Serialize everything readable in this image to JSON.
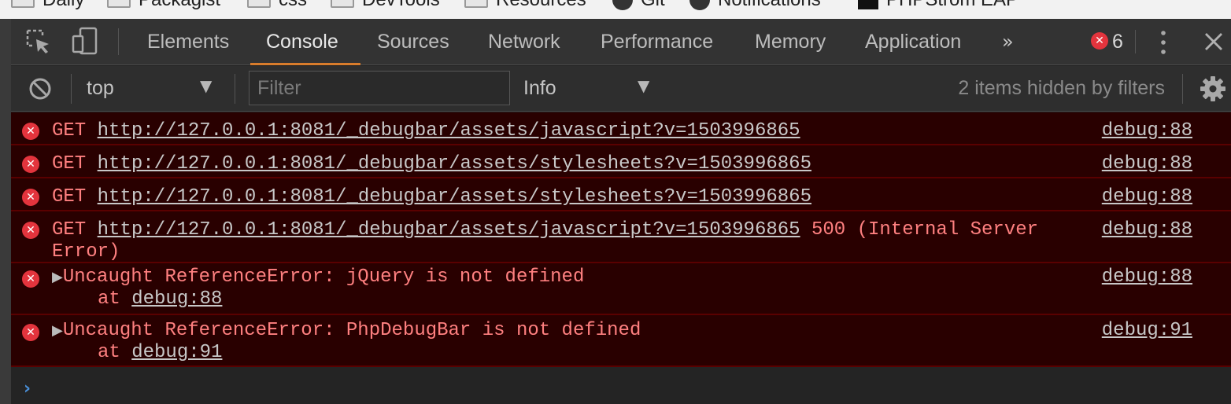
{
  "bookmarks": [
    {
      "label": "Daily",
      "icon": "folder-icon"
    },
    {
      "label": "Packagist",
      "icon": "folder-icon"
    },
    {
      "label": "css",
      "icon": "folder-icon"
    },
    {
      "label": "DevTools",
      "icon": "folder-icon"
    },
    {
      "label": "Resources",
      "icon": "folder-icon"
    },
    {
      "label": "Git",
      "icon": "github-icon"
    },
    {
      "label": "Notifications",
      "icon": "github-icon"
    },
    {
      "label": "PHPStrom EAP",
      "icon": "terminal-icon"
    }
  ],
  "tabs": [
    "Elements",
    "Console",
    "Sources",
    "Network",
    "Performance",
    "Memory",
    "Application"
  ],
  "active_tab": "Console",
  "more_tabs": "»",
  "error_count": "6",
  "filterbar": {
    "context": "top",
    "filter_placeholder": "Filter",
    "level": "Info",
    "hidden_text": "2 items hidden by filters"
  },
  "messages": [
    {
      "method": "GET",
      "url": "http://127.0.0.1:8081/_debugbar/assets/javascript?v=1503996865",
      "source": "debug:88"
    },
    {
      "method": "GET",
      "url": "http://127.0.0.1:8081/_debugbar/assets/stylesheets?v=1503996865",
      "source": "debug:88"
    },
    {
      "method": "GET",
      "url": "http://127.0.0.1:8081/_debugbar/assets/stylesheets?v=1503996865",
      "source": "debug:88"
    },
    {
      "method": "GET",
      "url": "http://127.0.0.1:8081/_debugbar/assets/javascript?v=1503996865",
      "status": "500 (Internal Server",
      "status_cont": "Error)",
      "source": "debug:88"
    },
    {
      "text": "Uncaught ReferenceError: jQuery is not defined",
      "at_prefix": "at",
      "at_link": "debug:88",
      "source": "debug:88"
    },
    {
      "text": "Uncaught ReferenceError: PhpDebugBar is not defined",
      "at_prefix": "at",
      "at_link": "debug:91",
      "source": "debug:91"
    }
  ],
  "colors": {
    "error_bg": "#290000",
    "error_text": "#ff8080",
    "error_icon": "#e3343d",
    "active_tab_underline": "#d87c2c",
    "prompt": "#4a90d9"
  }
}
